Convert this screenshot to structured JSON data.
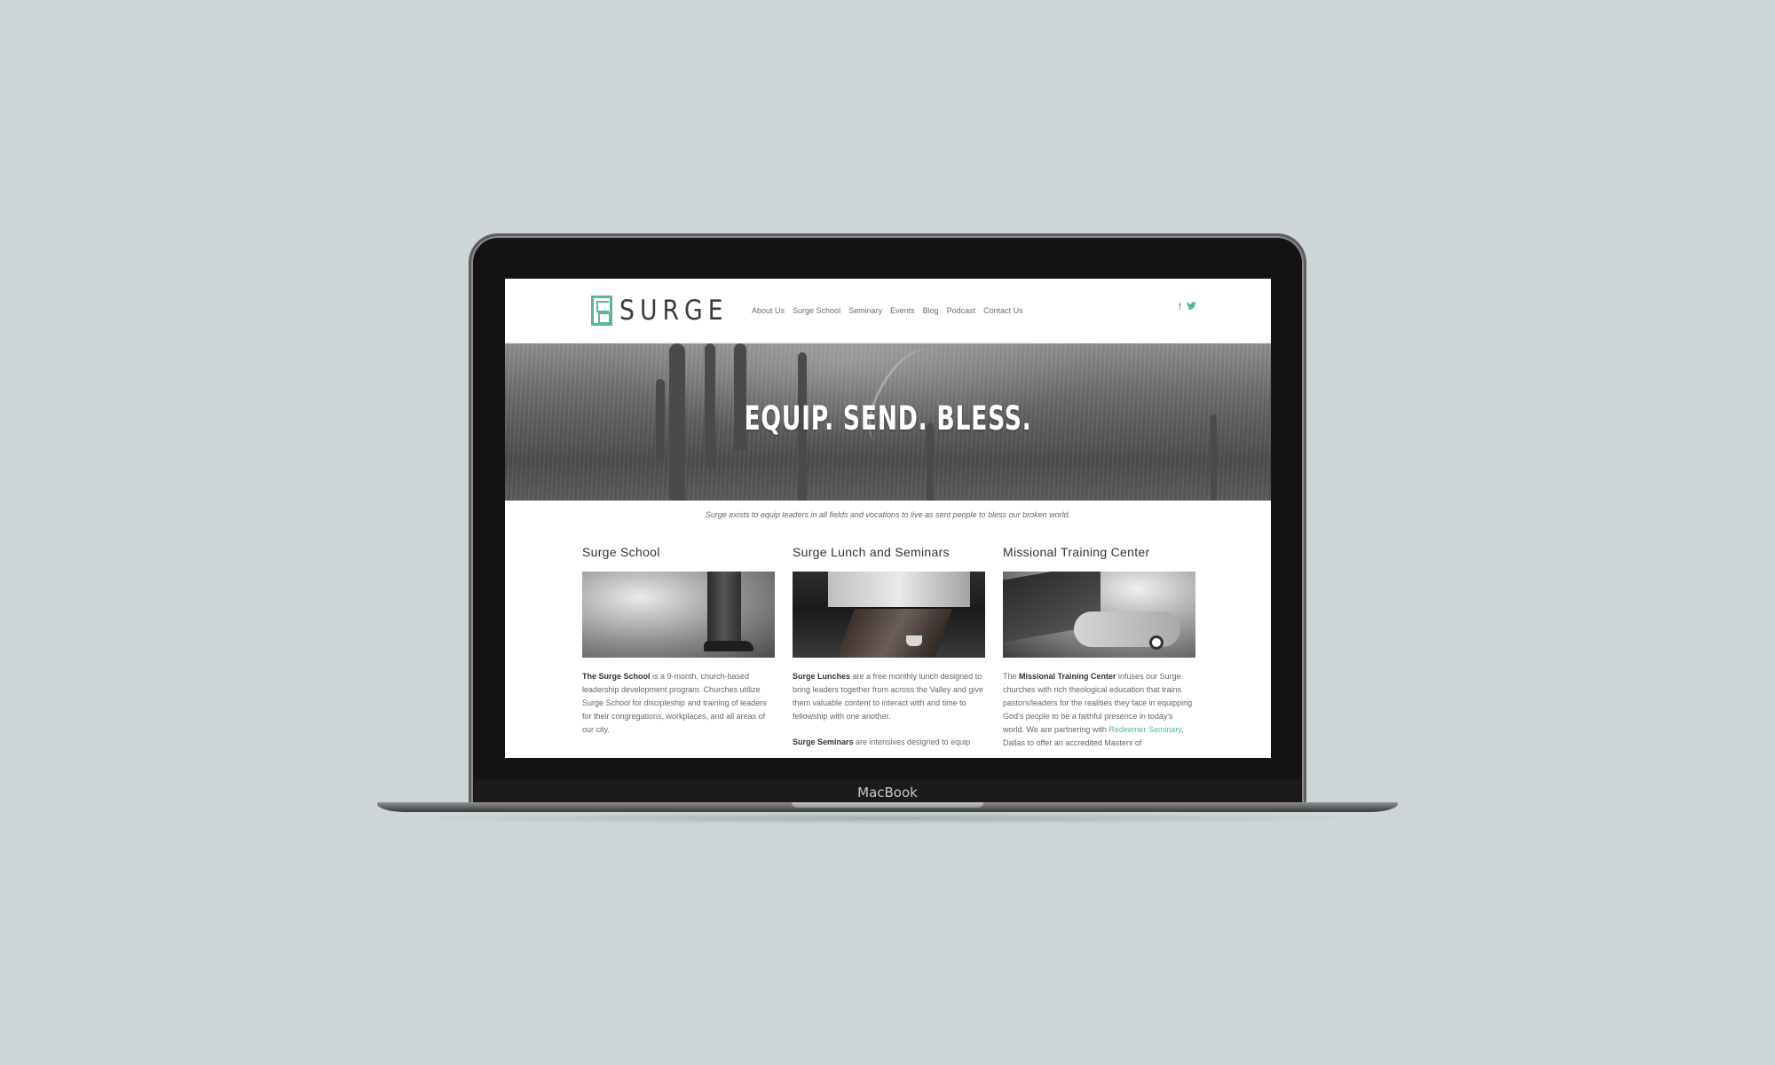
{
  "device": {
    "label": "MacBook"
  },
  "site": {
    "logo_text": "SURGE",
    "nav": [
      "About Us",
      "Surge School",
      "Seminary",
      "Events",
      "Blog",
      "Podcast",
      "Contact Us"
    ],
    "social": {
      "facebook": "f",
      "twitter": "🐦"
    },
    "hero_title": "EQUIP. SEND. BLESS.",
    "tagline": "Surge exists to equip leaders in all fields and vocations to live as sent people to bless our broken world.",
    "columns": [
      {
        "title": "Surge School",
        "intro_bold": "The Surge School",
        "intro_rest": " is a 9-month, church-based leadership development program. Churches utilize Surge School for discipleship and training of leaders for their congregations, workplaces, and all areas of our city."
      },
      {
        "title": "Surge Lunch and Seminars",
        "intro_bold": "Surge Lunches",
        "intro_rest": " are a free monthly lunch designed to bring leaders together from across the Valley and give them valuable content to interact with and time to fellowship with one another.",
        "second_bold": "Surge Seminars",
        "second_rest": " are intensives designed to equip"
      },
      {
        "title": "Missional Training Center",
        "intro_pre": "The ",
        "intro_bold": "Missional Training Center",
        "intro_rest": " infuses our Surge churches with rich theological education that trains pastors/leaders for the realities they face in equipping God's people to be a faithful presence in today's world. We are partnering with ",
        "link": "Redeemer Seminary",
        "intro_post": ", Dallas to offer an accredited Masters of"
      }
    ]
  },
  "colors": {
    "accent": "#5bb598",
    "background": "#cdd5d6"
  }
}
